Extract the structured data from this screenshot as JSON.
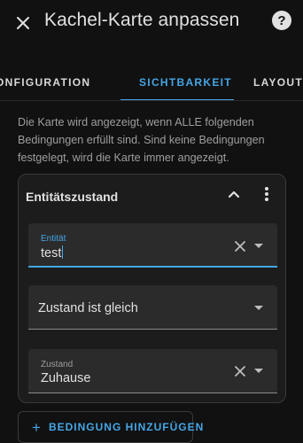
{
  "header": {
    "title": "Kachel-Karte anpassen",
    "close_icon": "close-icon",
    "help_icon": "help-icon",
    "help_glyph": "?"
  },
  "tabs": [
    {
      "label": "KONFIGURATION",
      "active": false
    },
    {
      "label": "SICHTBARKEIT",
      "active": true
    },
    {
      "label": "LAYOUT",
      "active": false
    }
  ],
  "description": "Die Karte wird angezeigt, wenn ALLE folgenden Bedingungen erfüllt sind. Sind keine Bedingungen festgelegt, wird die Karte immer angezeigt.",
  "condition_card": {
    "title": "Entitätszustand",
    "collapse_icon": "chevron-up-icon",
    "menu_icon": "more-vertical-icon",
    "entity_field": {
      "label": "Entität",
      "value": "test"
    },
    "operator_field": {
      "value": "Zustand ist gleich"
    },
    "state_field": {
      "label": "Zustand",
      "value": "Zuhause"
    }
  },
  "add_button": {
    "icon": "plus-icon",
    "glyph": "+",
    "label": "BEDINGUNG HINZUFÜGEN"
  },
  "colors": {
    "accent": "#45a6e6",
    "background": "#111111",
    "card": "#1c1c1c",
    "field": "#2b2b2b"
  }
}
